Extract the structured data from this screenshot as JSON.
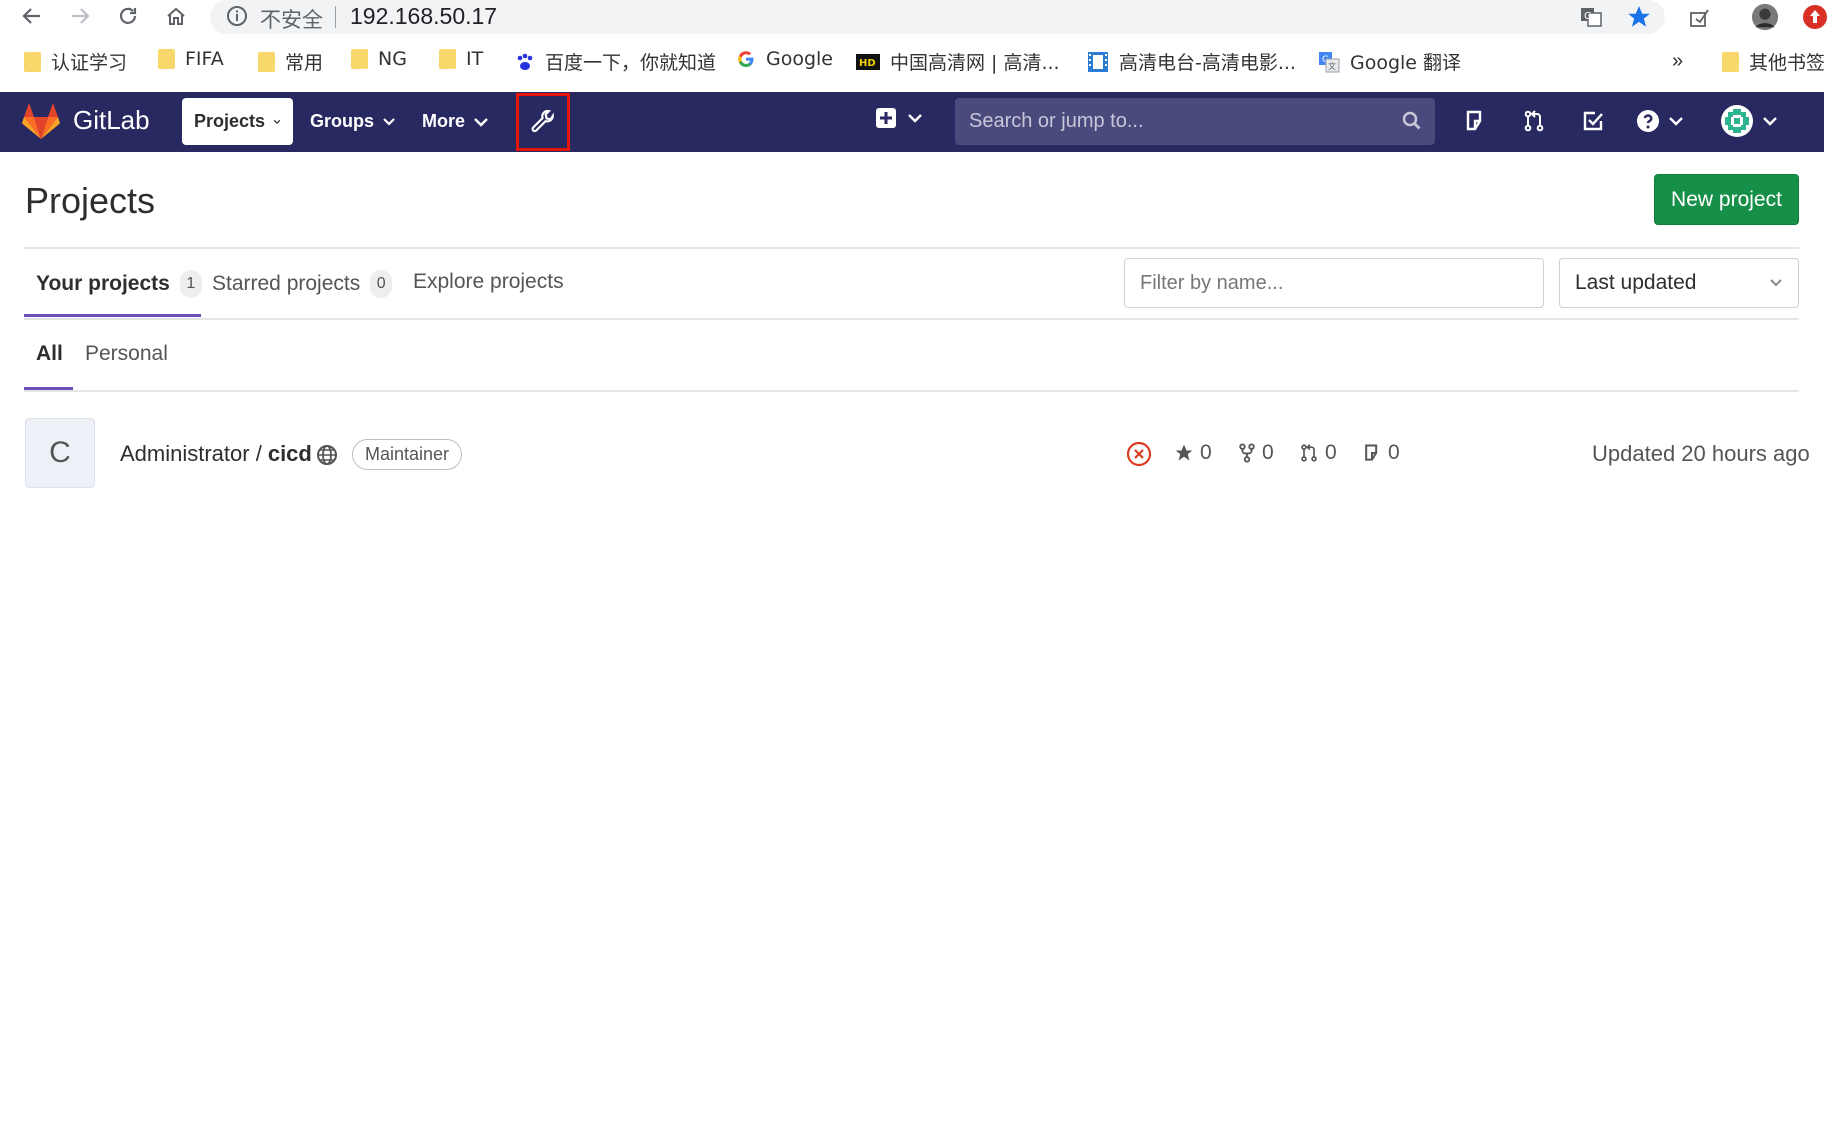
{
  "browser": {
    "insecure_label": "不安全",
    "url": "192.168.50.17",
    "bookmarks": [
      {
        "label": "认证学习",
        "icon": "folder-icon"
      },
      {
        "label": "FIFA",
        "icon": "folder-icon"
      },
      {
        "label": "常用",
        "icon": "folder-icon"
      },
      {
        "label": "NG",
        "icon": "folder-icon"
      },
      {
        "label": "IT",
        "icon": "folder-icon"
      },
      {
        "label": "百度一下，你就知道",
        "icon": "baidu-icon"
      },
      {
        "label": "Google",
        "icon": "google-icon"
      },
      {
        "label": "中国高清网 | 高清...",
        "icon": "hd-icon"
      },
      {
        "label": "高清电台-高清电影...",
        "icon": "film-icon"
      },
      {
        "label": "Google 翻译",
        "icon": "translate-icon"
      },
      {
        "label": "其他书签",
        "icon": "folder-icon"
      }
    ],
    "more_label": "»"
  },
  "navbar": {
    "brand": "GitLab",
    "items": [
      {
        "label": "Projects"
      },
      {
        "label": "Groups"
      },
      {
        "label": "More"
      }
    ],
    "search_placeholder": "Search or jump to..."
  },
  "page": {
    "title": "Projects",
    "new_project_label": "New project",
    "tabs": [
      {
        "label": "Your projects",
        "count": "1"
      },
      {
        "label": "Starred projects",
        "count": "0"
      },
      {
        "label": "Explore projects"
      }
    ],
    "filter_placeholder": "Filter by name...",
    "sort_label": "Last updated",
    "subtabs": [
      {
        "label": "All"
      },
      {
        "label": "Personal"
      }
    ]
  },
  "projects": [
    {
      "avatar_letter": "C",
      "namespace": "Administrator / ",
      "name": "cicd",
      "role": "Maintainer",
      "stars": "0",
      "forks": "0",
      "merge_requests": "0",
      "issues": "0",
      "updated": "Updated 20 hours ago"
    }
  ],
  "colors": {
    "navbar_bg": "#292961",
    "new_project_bg": "#168f48",
    "highlight_border": "#e8150e",
    "tab_underline": "#6b4fbb",
    "pipeline_failed": "#db3b21"
  }
}
